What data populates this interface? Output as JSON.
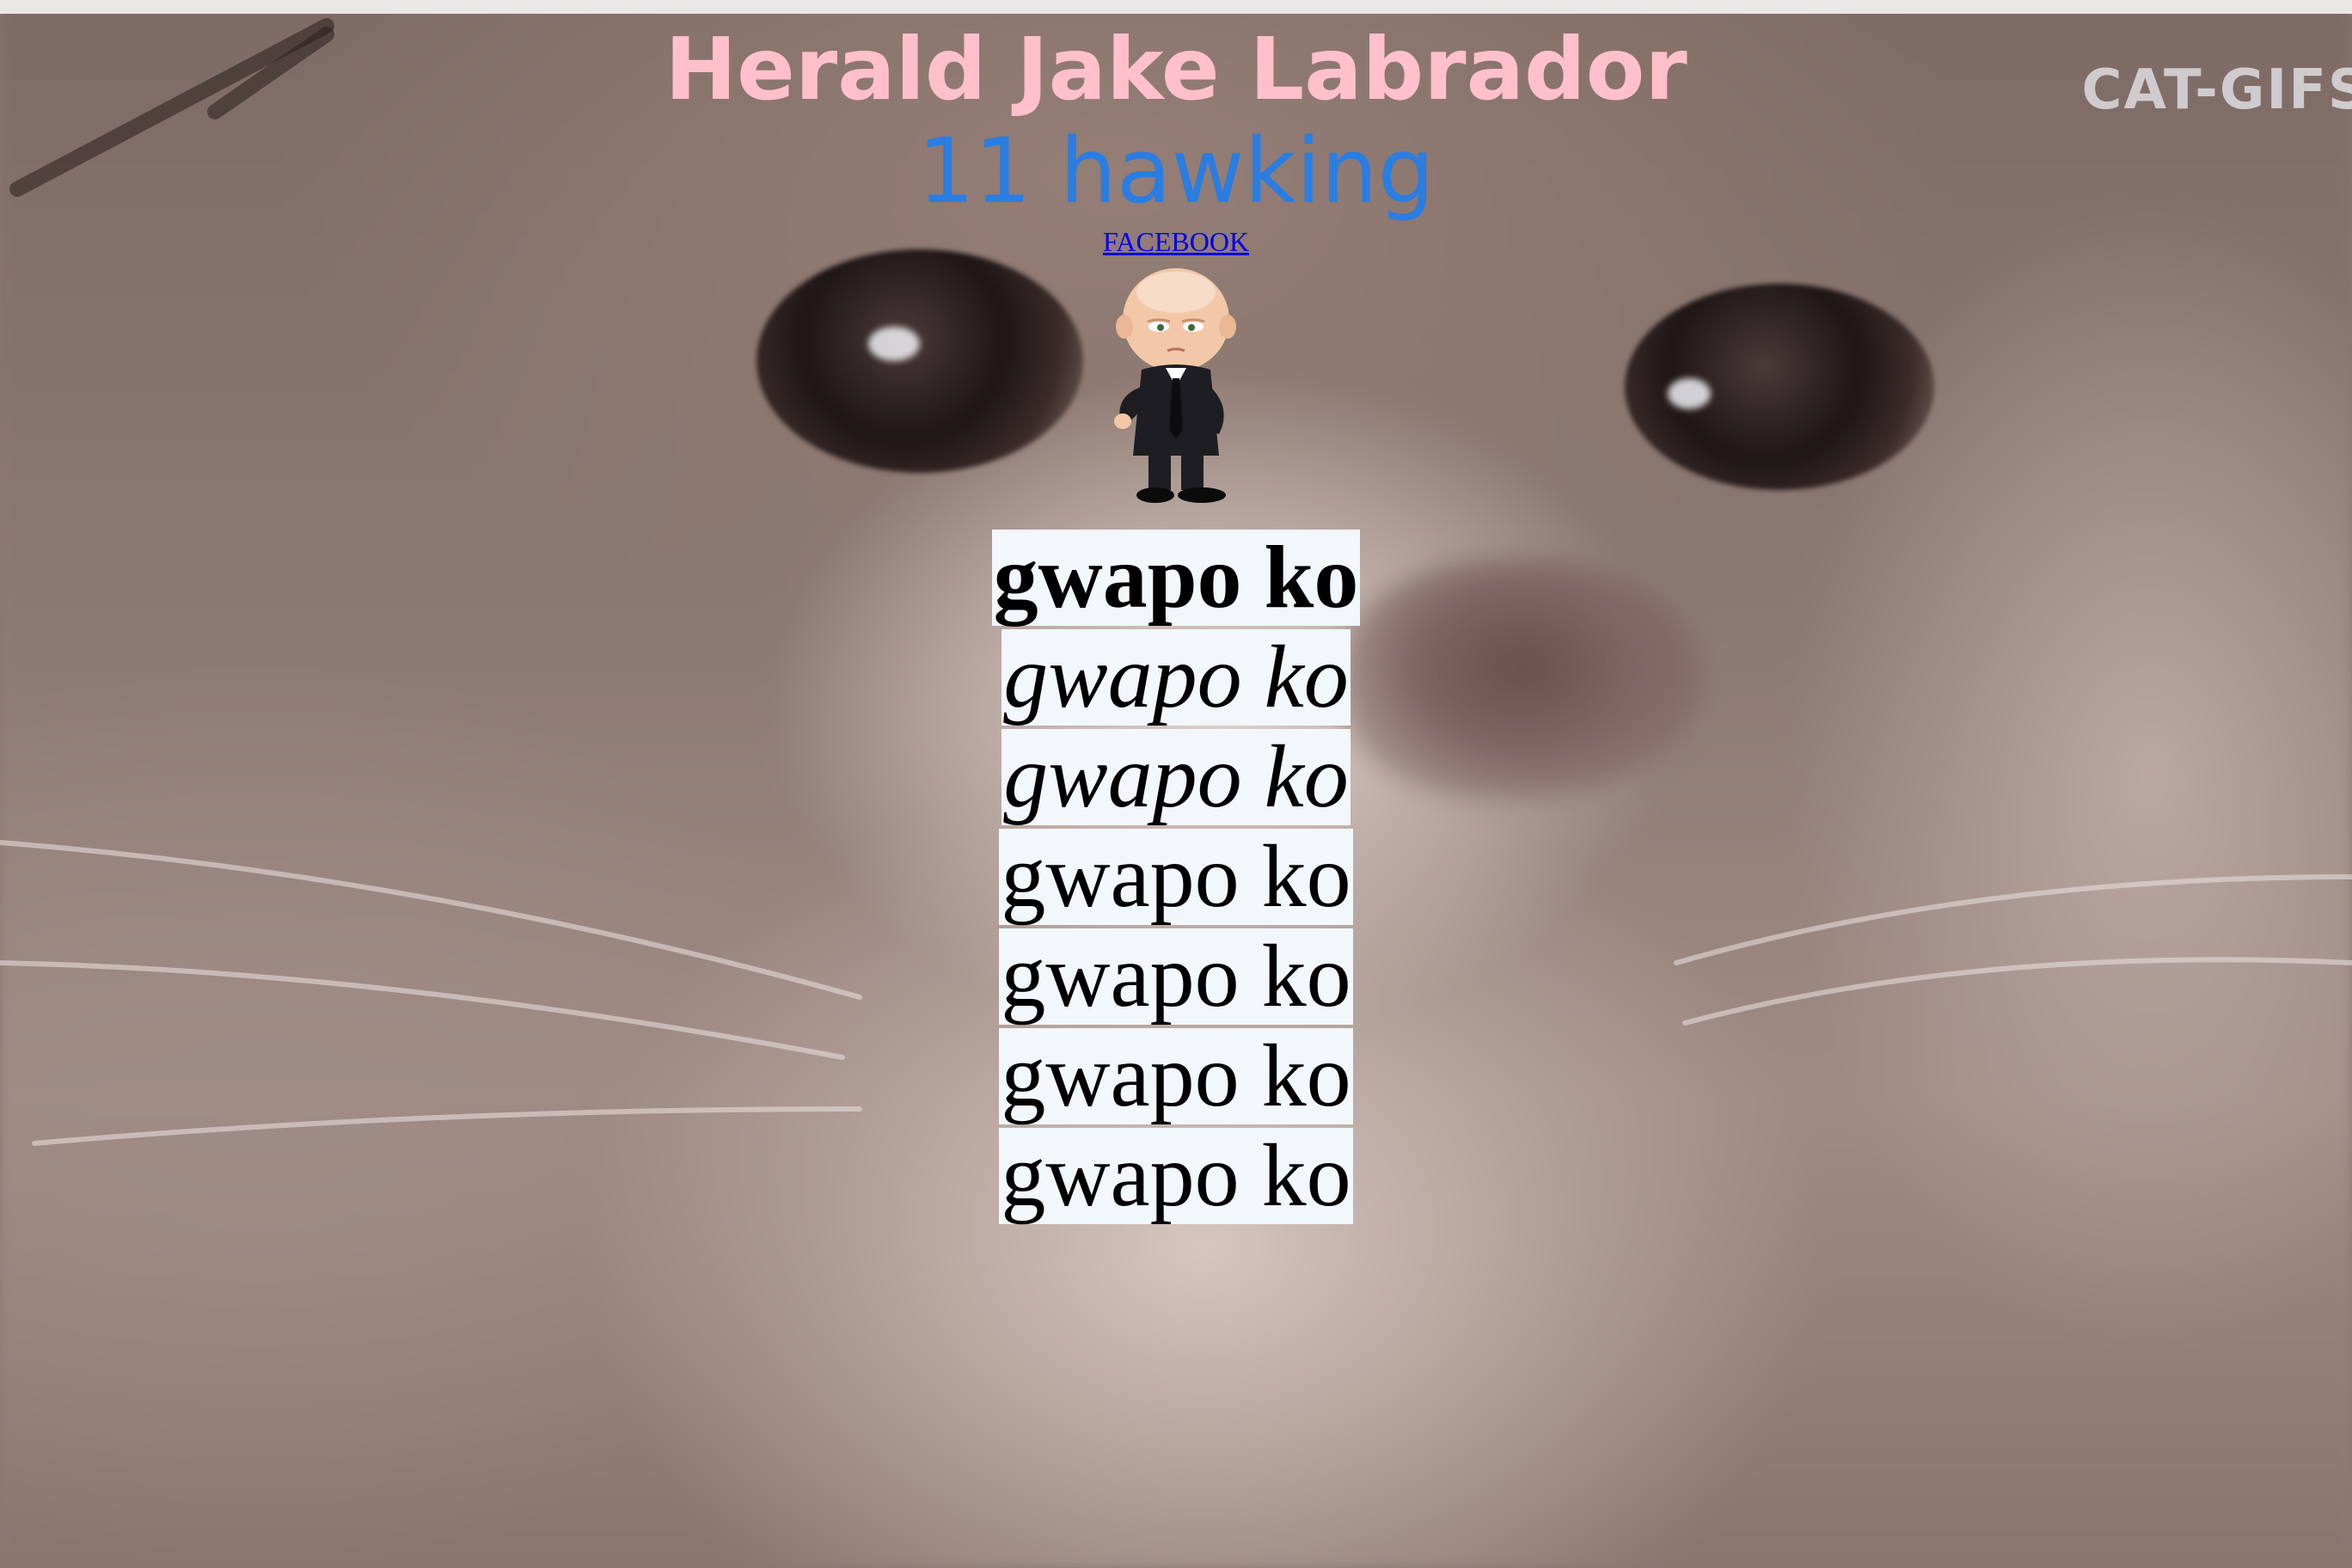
{
  "background": {
    "watermark": "CAT-GIFS"
  },
  "header": {
    "title": "Herald Jake Labrador",
    "title_color": "#ffc0cb",
    "subtitle": "11 hawking",
    "subtitle_color": "#2a7de1"
  },
  "link": {
    "label": "FACEBOOK",
    "color": "#0000ee"
  },
  "image": {
    "icon": "boss-baby-figure"
  },
  "words": [
    {
      "text": "gwapo ko",
      "style": "bold"
    },
    {
      "text": "gwapo ko",
      "style": "italic"
    },
    {
      "text": "gwapo ko",
      "style": "italic"
    },
    {
      "text": "gwapo ko",
      "style": "normal"
    },
    {
      "text": "gwapo ko",
      "style": "normal"
    },
    {
      "text": "gwapo ko",
      "style": "normal"
    },
    {
      "text": "gwapo ko",
      "style": "normal"
    }
  ]
}
